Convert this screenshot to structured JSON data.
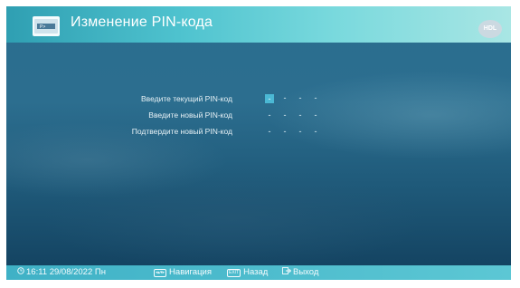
{
  "header": {
    "title": "Изменение PIN-кода",
    "icon": "keyboard-icon",
    "logo": "HDL"
  },
  "form": {
    "rows": [
      {
        "label": "Введите текущий PIN-код",
        "slots": [
          "-",
          "-",
          "-",
          "-"
        ]
      },
      {
        "label": "Введите новый PIN-код",
        "slots": [
          "-",
          "-",
          "-",
          "-"
        ]
      },
      {
        "label": "Подтвердите новый PIN-код",
        "slots": [
          "-",
          "-",
          "-",
          "-"
        ]
      }
    ]
  },
  "footer": {
    "datetime": "16:11 29/08/2022 Пн",
    "nav_label": "Навигация",
    "back_label": "Назад",
    "exit_label": "Выход"
  },
  "colors": {
    "header_gradient_start": "#2f9fb2",
    "header_gradient_end": "#a9e6e4",
    "active_slot": "#4bb8d4",
    "footer": "#4cbcd0"
  }
}
